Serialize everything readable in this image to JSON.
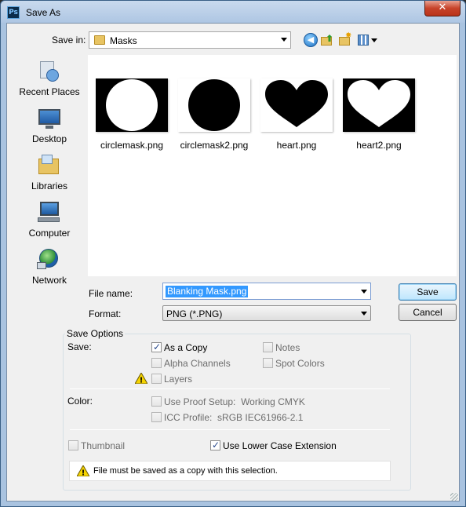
{
  "window": {
    "title": "Save As",
    "app_icon_text": "Ps",
    "close_symbol": "✕"
  },
  "toolbar": {
    "save_in_label": "Save in:",
    "save_in_value": "Masks",
    "back_icon": "back-arrow-icon",
    "up_icon": "up-folder-icon",
    "new_folder_icon": "new-folder-icon",
    "views_icon": "views-menu-icon"
  },
  "places": [
    {
      "label": "Recent Places",
      "icon": "recent-places-icon"
    },
    {
      "label": "Desktop",
      "icon": "desktop-icon"
    },
    {
      "label": "Libraries",
      "icon": "libraries-icon"
    },
    {
      "label": "Computer",
      "icon": "computer-icon"
    },
    {
      "label": "Network",
      "icon": "network-icon"
    }
  ],
  "files": [
    {
      "name": "circlemask.png",
      "shape": "circle",
      "fg": "#ffffff",
      "bg": "#000000"
    },
    {
      "name": "circlemask2.png",
      "shape": "circle",
      "fg": "#000000",
      "bg": "#ffffff"
    },
    {
      "name": "heart.png",
      "shape": "heart",
      "fg": "#000000",
      "bg": "#ffffff"
    },
    {
      "name": "heart2.png",
      "shape": "heart",
      "fg": "#ffffff",
      "bg": "#000000"
    }
  ],
  "filename": {
    "label": "File name:",
    "value": "Blanking Mask.png"
  },
  "format": {
    "label": "Format:",
    "value": "PNG (*.PNG)"
  },
  "buttons": {
    "save": "Save",
    "cancel": "Cancel"
  },
  "save_options": {
    "title": "Save Options",
    "save_label": "Save:",
    "as_a_copy": {
      "label": "As a Copy",
      "checked": true,
      "enabled": true
    },
    "notes": {
      "label": "Notes",
      "checked": false,
      "enabled": false
    },
    "alpha_channels": {
      "label": "Alpha Channels",
      "checked": false,
      "enabled": false
    },
    "spot_colors": {
      "label": "Spot Colors",
      "checked": false,
      "enabled": false
    },
    "layers": {
      "label": "Layers",
      "checked": false,
      "enabled": false
    },
    "color_label": "Color:",
    "use_proof_setup": {
      "label": "Use Proof Setup:",
      "value": "Working CMYK",
      "checked": false,
      "enabled": false
    },
    "icc_profile": {
      "label": "ICC Profile:",
      "value": "sRGB IEC61966-2.1",
      "checked": false,
      "enabled": false
    },
    "thumbnail": {
      "label": "Thumbnail",
      "checked": false,
      "enabled": false
    },
    "lower_case_extension": {
      "label": "Use Lower Case Extension",
      "checked": true,
      "enabled": true
    }
  },
  "warning": {
    "message": "File must be saved as a copy with this selection.",
    "icon": "warning-icon",
    "color": "#f5d300"
  }
}
